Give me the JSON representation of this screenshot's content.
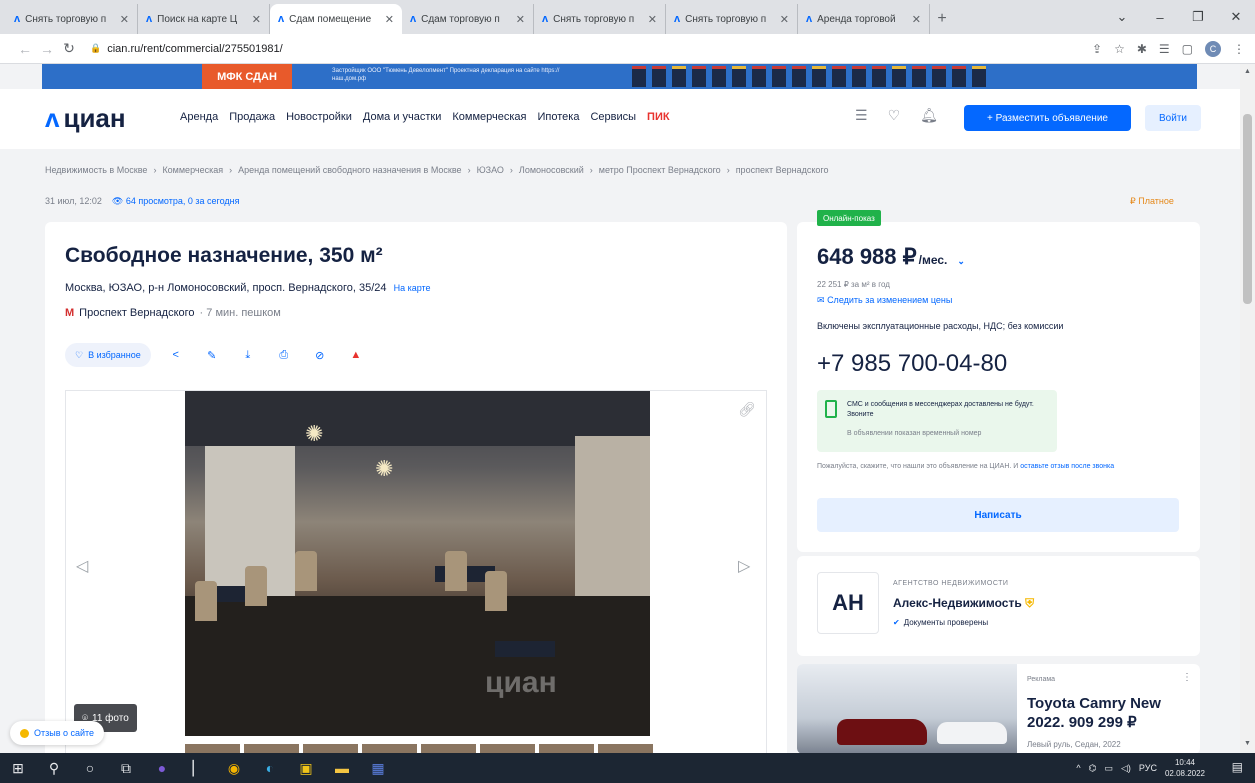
{
  "browser": {
    "tabs": [
      {
        "title": "Снять торговую п",
        "active": false
      },
      {
        "title": "Поиск на карте Ц",
        "active": false
      },
      {
        "title": "Сдам помещение",
        "active": true
      },
      {
        "title": "Сдам торговую п",
        "active": false
      },
      {
        "title": "Снять торговую п",
        "active": false
      },
      {
        "title": "Снять торговую п",
        "active": false
      },
      {
        "title": "Аренда торговой",
        "active": false
      }
    ],
    "new_tab": "+",
    "url": "cian.ru/rent/commercial/275501981/"
  },
  "ad_banner": {
    "brand": "МФК СДАН",
    "text": "Застройщик ООО \"Тюмень Девелопмент\" Проектная декларация на сайте https://наш.дом.рф"
  },
  "header": {
    "logo": "циан",
    "nav": [
      "Аренда",
      "Продажа",
      "Новостройки",
      "Дома и участки",
      "Коммерческая",
      "Ипотека",
      "Сервисы"
    ],
    "pik": "ПИК",
    "post_button": "+ Разместить объявление",
    "login_button": "Войти"
  },
  "breadcrumbs": [
    "Недвижимость в Москве",
    "Коммерческая",
    "Аренда помещений свободного назначения в Москве",
    "ЮЗАО",
    "Ломоносовский",
    "метро Проспект Вернадского",
    "проспект Вернадского"
  ],
  "meta": {
    "date": "31 июл, 12:02",
    "views": "64 просмотра, 0 за сегодня",
    "paid": "Платное"
  },
  "listing": {
    "title": "Свободное назначение, 350 м²",
    "address": "Москва, ЮЗАО, р-н Ломоносовский, просп. Вернадского, 35/24",
    "on_map": "На карте",
    "metro_station": "Проспект Вернадского",
    "metro_walk": "· 7 мин. пешком",
    "favorite": "В избранное",
    "photo_count": "11 фото",
    "watermark": "циан"
  },
  "sidebar": {
    "online_badge": "Онлайн-показ",
    "price": "648 988 ₽",
    "price_unit": "/мес.",
    "per_m2": "22 251 ₽ за м² в год",
    "follow_price": "Следить за изменением цены",
    "included": "Включены эксплуатационные расходы, НДС; без комиссии",
    "phone": "+7 985 700-04-80",
    "sms_notice": "СМС и сообщения в мессенджерах доставлены не будут. Звоните",
    "temp_number": "В объявлении показан временный номер",
    "please_text": "Пожалуйста, скажите, что нашли это объявление на ЦИАН. И",
    "please_link": "оставьте отзыв после звонка",
    "write_button": "Написать"
  },
  "agency": {
    "logo": "АН",
    "label": "АГЕНТСТВО НЕДВИЖИМОСТИ",
    "name": "Алекс-Недвижимость",
    "docs": "Документы проверены"
  },
  "ad_card": {
    "label": "Реклама",
    "title": "Toyota Camry New 2022. 909 299 ₽",
    "subtitle": "Левый руль, Седан, 2022"
  },
  "feedback": "Отзыв о сайте",
  "taskbar": {
    "lang": "РУС",
    "time": "10:44",
    "date": "02.08.2022"
  },
  "colors": {
    "brand_blue": "#0468ff",
    "online_green": "#20b24a",
    "pik_red": "#e8322e"
  }
}
